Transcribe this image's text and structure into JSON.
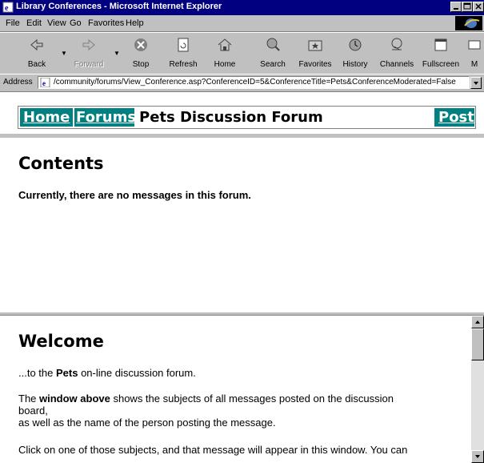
{
  "window": {
    "title": "Library Conferences - Microsoft Internet Explorer"
  },
  "menu": {
    "items": [
      "File",
      "Edit",
      "View",
      "Go",
      "Favorites",
      "Help"
    ]
  },
  "toolbar": {
    "buttons": [
      {
        "label": "Back",
        "icon": "back-arrow-icon",
        "enabled": true
      },
      {
        "label": "Forward",
        "icon": "forward-arrow-icon",
        "enabled": false
      },
      {
        "label": "Stop",
        "icon": "stop-icon",
        "enabled": true
      },
      {
        "label": "Refresh",
        "icon": "refresh-icon",
        "enabled": true
      },
      {
        "label": "Home",
        "icon": "home-icon",
        "enabled": true
      },
      {
        "label": "Search",
        "icon": "search-icon",
        "enabled": true
      },
      {
        "label": "Favorites",
        "icon": "favorites-icon",
        "enabled": true
      },
      {
        "label": "History",
        "icon": "history-icon",
        "enabled": true
      },
      {
        "label": "Channels",
        "icon": "channels-icon",
        "enabled": true
      },
      {
        "label": "Fullscreen",
        "icon": "fullscreen-icon",
        "enabled": true
      },
      {
        "label": "M",
        "icon": "mail-icon",
        "enabled": true
      }
    ]
  },
  "address": {
    "label": "Address",
    "url": "/community/forums/View_Conference.asp?ConferenceID=5&ConferenceTitle=Pets&ConferenceModerated=False"
  },
  "nav": {
    "home": "Home",
    "forums": "Forums",
    "title": "Pets Discussion Forum",
    "post": "Post",
    "link_bg": "#008080"
  },
  "contents": {
    "heading": "Contents",
    "message": "Currently, there are no messages in this forum."
  },
  "welcome": {
    "heading": "Welcome",
    "line1_pre": "...to the ",
    "line1_bold": "Pets",
    "line1_post": " on-line discussion forum.",
    "line2_pre": "The ",
    "line2_bold": "window above",
    "line2_post": " shows the subjects of all messages posted on the discussion",
    "line3": "board,",
    "line4": "as well as the name of the person posting the message.",
    "line5": "Click on one of those subjects, and that message will appear in this window. You can"
  }
}
